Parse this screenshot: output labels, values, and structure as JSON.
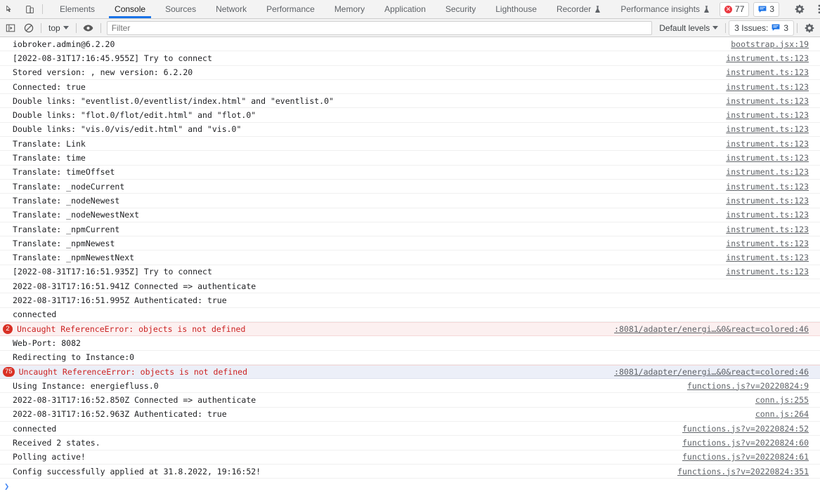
{
  "tabbar": {
    "inspect_icon": "inspect-cursor-icon",
    "device_icon": "device-toolbar-icon",
    "tabs": [
      {
        "label": "Elements",
        "active": false,
        "flask": false
      },
      {
        "label": "Console",
        "active": true,
        "flask": false
      },
      {
        "label": "Sources",
        "active": false,
        "flask": false
      },
      {
        "label": "Network",
        "active": false,
        "flask": false
      },
      {
        "label": "Performance",
        "active": false,
        "flask": false
      },
      {
        "label": "Memory",
        "active": false,
        "flask": false
      },
      {
        "label": "Application",
        "active": false,
        "flask": false
      },
      {
        "label": "Security",
        "active": false,
        "flask": false
      },
      {
        "label": "Lighthouse",
        "active": false,
        "flask": false
      },
      {
        "label": "Recorder",
        "active": false,
        "flask": true
      },
      {
        "label": "Performance insights",
        "active": false,
        "flask": true
      }
    ],
    "error_count": "77",
    "message_count": "3",
    "settings_icon": "gear-icon",
    "more_icon": "more-vertical-icon",
    "close_icon": "close-icon"
  },
  "consolebar": {
    "sidebar_icon": "console-sidebar-icon",
    "clear_icon": "clear-console-icon",
    "context": "top",
    "eye_icon": "live-expression-eye-icon",
    "filter_placeholder": "Filter",
    "filter_value": "",
    "levels": "Default levels",
    "issues_label": "3 Issues:",
    "issues_count": "3",
    "settings_icon": "console-settings-gear-icon"
  },
  "console_rows": [
    {
      "type": "log",
      "text": "iobroker.admin@6.2.20",
      "source": "bootstrap.jsx:19"
    },
    {
      "type": "log",
      "text": "[2022-08-31T17:16:45.955Z] Try to connect",
      "source": "instrument.ts:123"
    },
    {
      "type": "log",
      "text": "Stored version: , new version: 6.2.20",
      "source": "instrument.ts:123"
    },
    {
      "type": "log",
      "text": "Connected: true",
      "source": "instrument.ts:123"
    },
    {
      "type": "log",
      "text": "Double links: \"eventlist.0/eventlist/index.html\" and \"eventlist.0\"",
      "source": "instrument.ts:123"
    },
    {
      "type": "log",
      "text": "Double links: \"flot.0/flot/edit.html\" and \"flot.0\"",
      "source": "instrument.ts:123"
    },
    {
      "type": "log",
      "text": "Double links: \"vis.0/vis/edit.html\" and \"vis.0\"",
      "source": "instrument.ts:123"
    },
    {
      "type": "log",
      "text": "Translate: Link",
      "source": "instrument.ts:123"
    },
    {
      "type": "log",
      "text": "Translate: time",
      "source": "instrument.ts:123"
    },
    {
      "type": "log",
      "text": "Translate: timeOffset",
      "source": "instrument.ts:123"
    },
    {
      "type": "log",
      "text": "Translate: _nodeCurrent",
      "source": "instrument.ts:123"
    },
    {
      "type": "log",
      "text": "Translate: _nodeNewest",
      "source": "instrument.ts:123"
    },
    {
      "type": "log",
      "text": "Translate: _nodeNewestNext",
      "source": "instrument.ts:123"
    },
    {
      "type": "log",
      "text": "Translate: _npmCurrent",
      "source": "instrument.ts:123"
    },
    {
      "type": "log",
      "text": "Translate: _npmNewest",
      "source": "instrument.ts:123"
    },
    {
      "type": "log",
      "text": "Translate: _npmNewestNext",
      "source": "instrument.ts:123"
    },
    {
      "type": "log",
      "text": "[2022-08-31T17:16:51.935Z] Try to connect",
      "source": "instrument.ts:123"
    },
    {
      "type": "log",
      "text": "2022-08-31T17:16:51.941Z Connected => authenticate",
      "source": ""
    },
    {
      "type": "log",
      "text": "2022-08-31T17:16:51.995Z Authenticated: true",
      "source": ""
    },
    {
      "type": "log",
      "text": "connected",
      "source": ""
    },
    {
      "type": "error",
      "badge": "2",
      "text": "Uncaught ReferenceError: objects is not defined",
      "source": ":8081/adapter/energi…&0&react=colored:46",
      "selected": false
    },
    {
      "type": "log",
      "text": "Web-Port: 8082",
      "source": ""
    },
    {
      "type": "log",
      "text": "Redirecting to Instance:0",
      "source": ""
    },
    {
      "type": "error",
      "badge": "75",
      "text": "Uncaught ReferenceError: objects is not defined",
      "source": ":8081/adapter/energi…&0&react=colored:46",
      "selected": true
    },
    {
      "type": "log",
      "text": "Using Instance: energiefluss.0",
      "source": "functions.js?v=20220824:9"
    },
    {
      "type": "log",
      "text": "2022-08-31T17:16:52.850Z Connected => authenticate",
      "source": "conn.js:255"
    },
    {
      "type": "log",
      "text": "2022-08-31T17:16:52.963Z Authenticated: true",
      "source": "conn.js:264"
    },
    {
      "type": "log",
      "text": "connected",
      "source": "functions.js?v=20220824:52"
    },
    {
      "type": "log",
      "text": "Received 2 states.",
      "source": "functions.js?v=20220824:60"
    },
    {
      "type": "log",
      "text": "Polling active!",
      "source": "functions.js?v=20220824:61"
    },
    {
      "type": "log",
      "text": "Config successfully applied at 31.8.2022, 19:16:52!",
      "source": "functions.js?v=20220824:351"
    }
  ],
  "prompt": {
    "chevron": "❯"
  }
}
